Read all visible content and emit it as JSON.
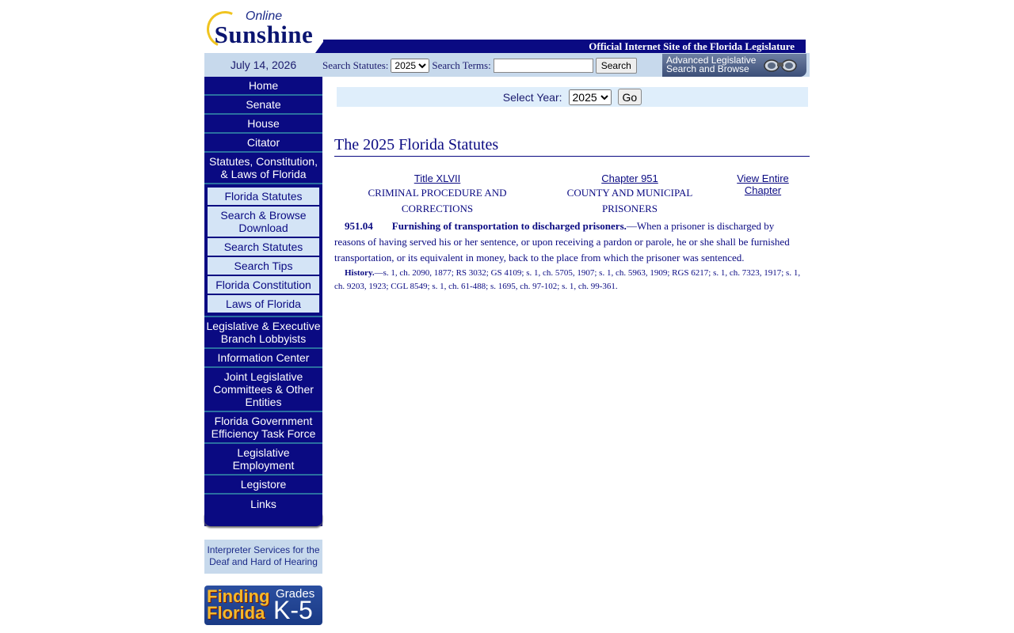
{
  "header": {
    "logo_top": "Online",
    "logo_main": "Sunshine",
    "banner": "Official Internet Site of the Florida Legislature",
    "date": "July 14, 2026",
    "search_statutes_label": "Search Statutes:",
    "search_year": "2025",
    "search_terms_label": "Search Terms:",
    "search_terms_value": "",
    "search_button": "Search",
    "advanced_line1": "Advanced Legislative",
    "advanced_line2": "Search and Browse"
  },
  "nav": {
    "items_top": [
      "Home",
      "Senate",
      "House",
      "Citator",
      "Statutes, Constitution, & Laws of Florida"
    ],
    "sub_items": [
      "Florida Statutes",
      "Search & Browse Download",
      "Search Statutes",
      "Search Tips",
      "Florida Constitution",
      "Laws of Florida"
    ],
    "items_bottom": [
      "Legislative & Executive Branch Lobbyists",
      "Information Center",
      "Joint Legislative Committees & Other Entities",
      "Florida Government Efficiency Task Force",
      "Legislative Employment",
      "Legistore",
      "Links"
    ]
  },
  "sidebar_promos": {
    "interpreter": "Interpreter Services for the Deaf and Hard of Hearing",
    "kids_title": "Finding Florida",
    "kids_grades": "Grades",
    "kids_level": "K-5"
  },
  "main": {
    "select_year_label": "Select Year:",
    "selected_year": "2025",
    "go_button": "Go",
    "title": "The 2025 Florida Statutes",
    "title_link": "Title XLVII",
    "title_name": "CRIMINAL PROCEDURE AND CORRECTIONS",
    "chapter_link": "Chapter 951",
    "chapter_name": "COUNTY AND MUNICIPAL PRISONERS",
    "view_chapter_link": "View Entire Chapter",
    "section_number": "951.04",
    "section_catchline": "Furnishing of transportation to discharged prisoners.",
    "section_text": "—When a prisoner is discharged by reasons of having served his or her sentence, or upon receiving a pardon or parole, he or she shall be furnished transportation, or its equivalent in money, back to the place from which the prisoner was sentenced.",
    "history_label": "History.",
    "history_text": "—s. 1, ch. 2090, 1877; RS 3032; GS 4109; s. 1, ch. 5705, 1907; s. 1, ch. 5963, 1909; RGS 6217; s. 1, ch. 7323, 1917; s. 1, ch. 9203, 1923; CGL 8549; s. 1, ch. 61-488; s. 1695, ch. 97-102; s. 1, ch. 99-361."
  }
}
